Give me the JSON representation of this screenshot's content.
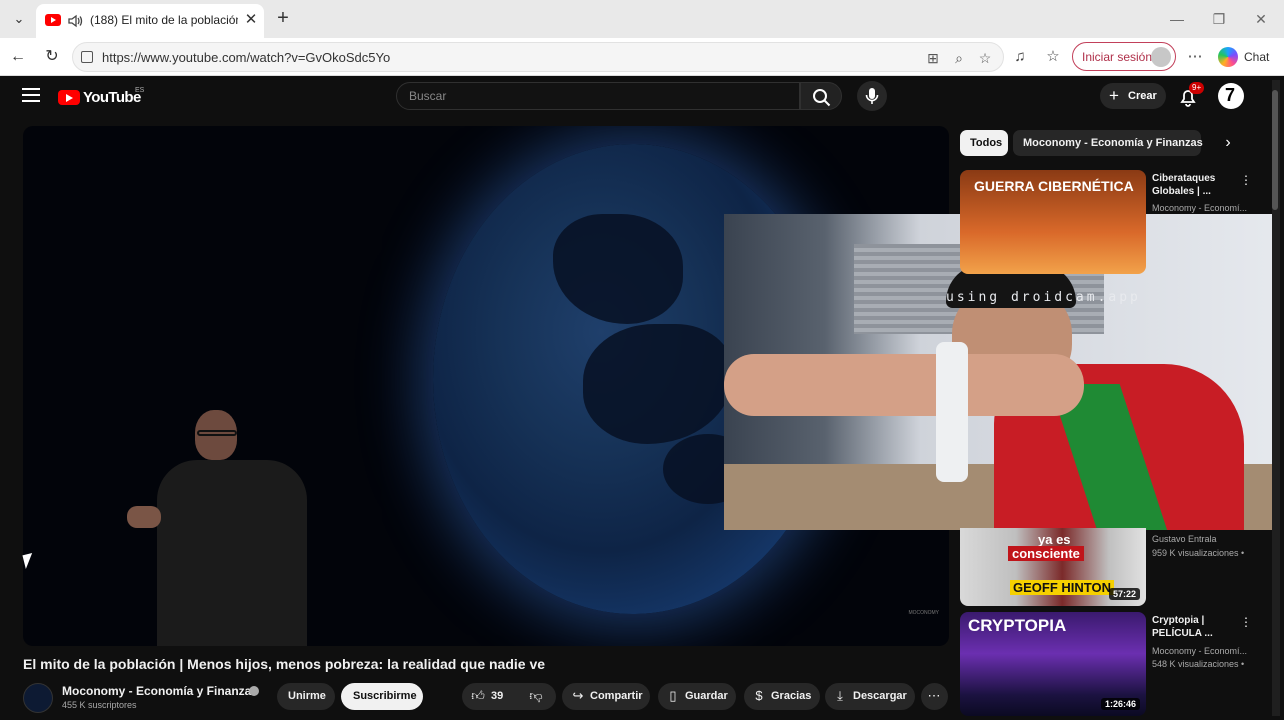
{
  "browser": {
    "tab_title": "(188) El mito de la población",
    "url": "https://www.youtube.com/watch?v=GvOkoSdc5Yo",
    "sign_in_label": "Iniciar sesión",
    "chat_label": "Chat"
  },
  "youtube": {
    "logo_text": "YouTube",
    "logo_country": "ES",
    "search_placeholder": "Buscar",
    "create_label": "Crear",
    "notifications_badge": "9+"
  },
  "video": {
    "title": "El mito de la población | Menos hijos, menos pobreza: la realidad que nadie ve",
    "channel_name": "Moconomy - Economía y Finanzas",
    "subscribers": "455 K suscriptores",
    "join_label": "Unirme",
    "subscribe_label": "Suscribirme",
    "likes": "39",
    "share_label": "Compartir",
    "save_label": "Guardar",
    "thanks_label": "Gracias",
    "download_label": "Descargar",
    "overlay_text": "using droidcam.app"
  },
  "sidebar": {
    "chips": [
      "Todos",
      "Moconomy - Economía y Finanzas"
    ],
    "recommendations": [
      {
        "thumb_text": "GUERRA CIBERNÉTICA",
        "title": "Ciberataques Globales | ...",
        "channel": "Moconomy - Economí...",
        "views": ""
      },
      {
        "thumb_text_1": "ya es",
        "thumb_text_2": "consciente",
        "thumb_text_3": "GEOFF HINTON",
        "duration": "57:22",
        "title": "",
        "channel": "Gustavo Entrala",
        "views": "959 K visualizaciones •"
      },
      {
        "thumb_text": "CRYPTOPIA",
        "duration": "1:26:46",
        "title": "Cryptopia | PELÍCULA ...",
        "channel": "Moconomy - Economí...",
        "views": "548 K visualizaciones •"
      }
    ]
  },
  "colors": {
    "yt_red": "#ff0000",
    "yt_background": "#0f0f0f",
    "sign_in_border": "#c2405a"
  }
}
